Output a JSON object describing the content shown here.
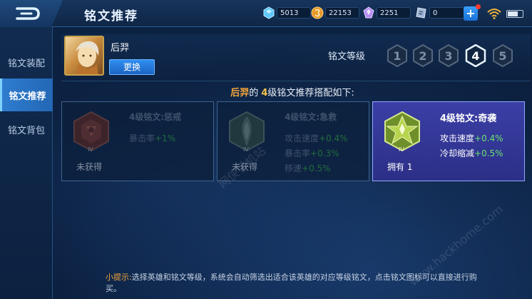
{
  "header": {
    "title": "铭文推荐",
    "resources": [
      {
        "icon": "diamond-icon",
        "value": "5013"
      },
      {
        "icon": "gold-coin-icon",
        "value": "22153"
      },
      {
        "icon": "gem-icon",
        "value": "2251"
      },
      {
        "icon": "voucher-icon",
        "value": "0"
      }
    ]
  },
  "sidebar": {
    "items": [
      {
        "label": "铭文装配"
      },
      {
        "label": "铭文推荐"
      },
      {
        "label": "铭文背包"
      }
    ]
  },
  "hero": {
    "name": "后羿",
    "change_label": "更换"
  },
  "level_selector": {
    "label": "铭文等级",
    "levels": [
      "1",
      "2",
      "3",
      "4",
      "5"
    ],
    "selected": "4"
  },
  "recommend": {
    "hero": "后羿",
    "mid1": "的 ",
    "level": "4",
    "suffix": "级铭文推荐搭配如下:"
  },
  "cards": [
    {
      "name": "4级铭文:惩戒",
      "stats": [
        {
          "label": "暴击率",
          "value": "+1%"
        }
      ],
      "status": "未获得",
      "roman": "IV"
    },
    {
      "name": "4级铭文:急救",
      "stats": [
        {
          "label": "攻击速度",
          "value": "+0.4%"
        },
        {
          "label": "暴击率",
          "value": "+0.3%"
        },
        {
          "label": "移速",
          "value": "+0.5%"
        }
      ],
      "status": "未获得",
      "roman": "IV"
    },
    {
      "name": "4级铭文:奇袭",
      "stats": [
        {
          "label": "攻击速度",
          "value": "+0.4%"
        },
        {
          "label": "冷却缩减",
          "value": "+0.5%"
        }
      ],
      "status": "拥有 1",
      "roman": "IV"
    }
  ],
  "tip": {
    "lead": "小提示:",
    "text": "选择英雄和铭文等级，系统会自动筛选出适合该英雄的对应等级铭文，点击铭文图标可以直接进行购买。"
  },
  "watermarks": [
    "网侠手机站",
    "www.hackhome.com"
  ]
}
